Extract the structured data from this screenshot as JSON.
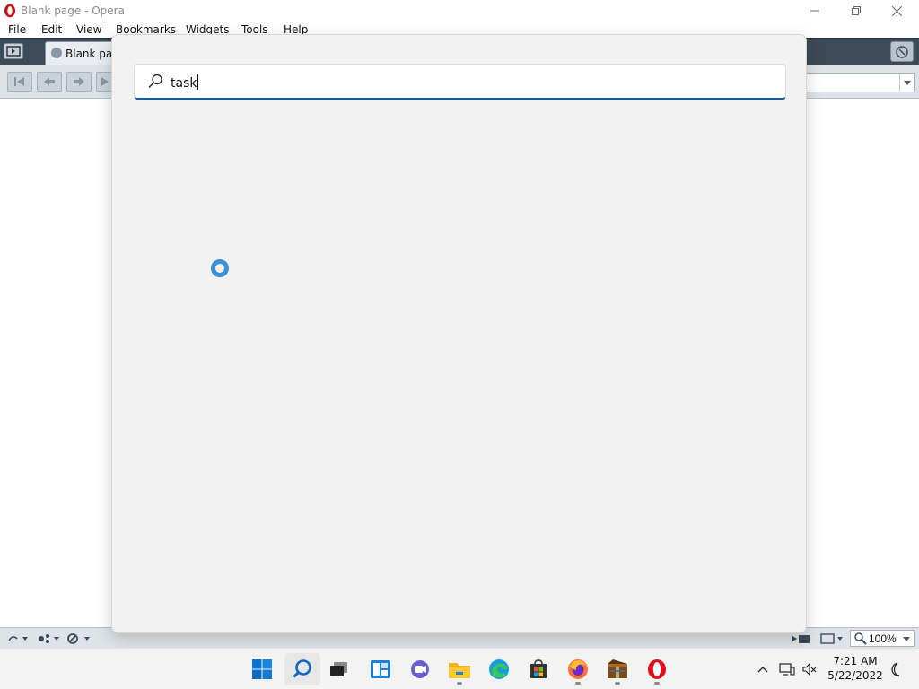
{
  "window": {
    "title": "Blank page - Opera"
  },
  "menu": [
    "File",
    "Edit",
    "View",
    "Bookmarks",
    "Widgets",
    "Tools",
    "Help"
  ],
  "tabs": [
    {
      "label": "Blank pag"
    }
  ],
  "status": {
    "zoom": "100%"
  },
  "search": {
    "query": "task"
  },
  "taskbar": {
    "apps": [
      {
        "name": "start-button"
      },
      {
        "name": "search-button"
      },
      {
        "name": "task-view-button"
      },
      {
        "name": "widgets-button"
      },
      {
        "name": "chat-button"
      },
      {
        "name": "file-explorer-button"
      },
      {
        "name": "edge-button"
      },
      {
        "name": "store-button"
      },
      {
        "name": "firefox-button"
      },
      {
        "name": "winrar-button"
      },
      {
        "name": "opera-button"
      }
    ],
    "time": "7:21 AM",
    "date": "5/22/2022"
  },
  "colors": {
    "accent": "#005fb8",
    "opera_red": "#cc0f16",
    "spinner": "#3b8fd6"
  }
}
